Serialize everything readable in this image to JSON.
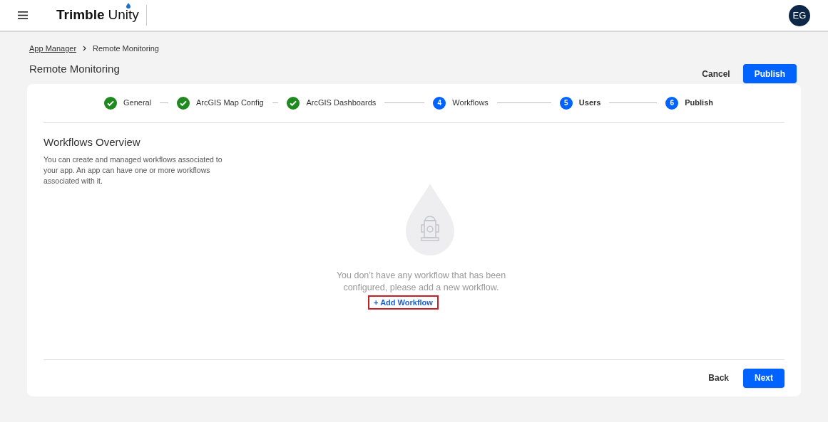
{
  "header": {
    "brand": {
      "bold": "Trimble",
      "light": "Unity"
    },
    "avatar": "EG"
  },
  "breadcrumb": [
    {
      "label": "App Manager",
      "link": true
    },
    {
      "label": "Remote Monitoring",
      "link": false
    }
  ],
  "page_title": "Remote Monitoring",
  "actions": [
    {
      "label": "Cancel",
      "kind": "secondary"
    },
    {
      "label": "Publish",
      "kind": "primary"
    }
  ],
  "steps": [
    {
      "kind": "done",
      "label": "General"
    },
    {
      "kind": "done",
      "label": "ArcGIS Map Config"
    },
    {
      "kind": "done",
      "label": "ArcGIS Dashboards"
    },
    {
      "kind": "current",
      "number": "4",
      "label": "Workflows"
    },
    {
      "kind": "upcoming",
      "number": "5",
      "label": "Users"
    },
    {
      "kind": "upcoming",
      "number": "6",
      "label": "Publish"
    }
  ],
  "section": {
    "title": "Workflows Overview",
    "description": "You can create and managed workflows associated to your app. An app can have one or more workflows associated with it."
  },
  "empty_state": {
    "message": "You don’t have any workflow that has been configured, please add a new workflow.",
    "action": {
      "label": "+ Add Workflow",
      "highlighted": true
    }
  },
  "footer": [
    {
      "label": "Back",
      "kind": "secondary"
    },
    {
      "label": "Next",
      "kind": "primary"
    }
  ]
}
